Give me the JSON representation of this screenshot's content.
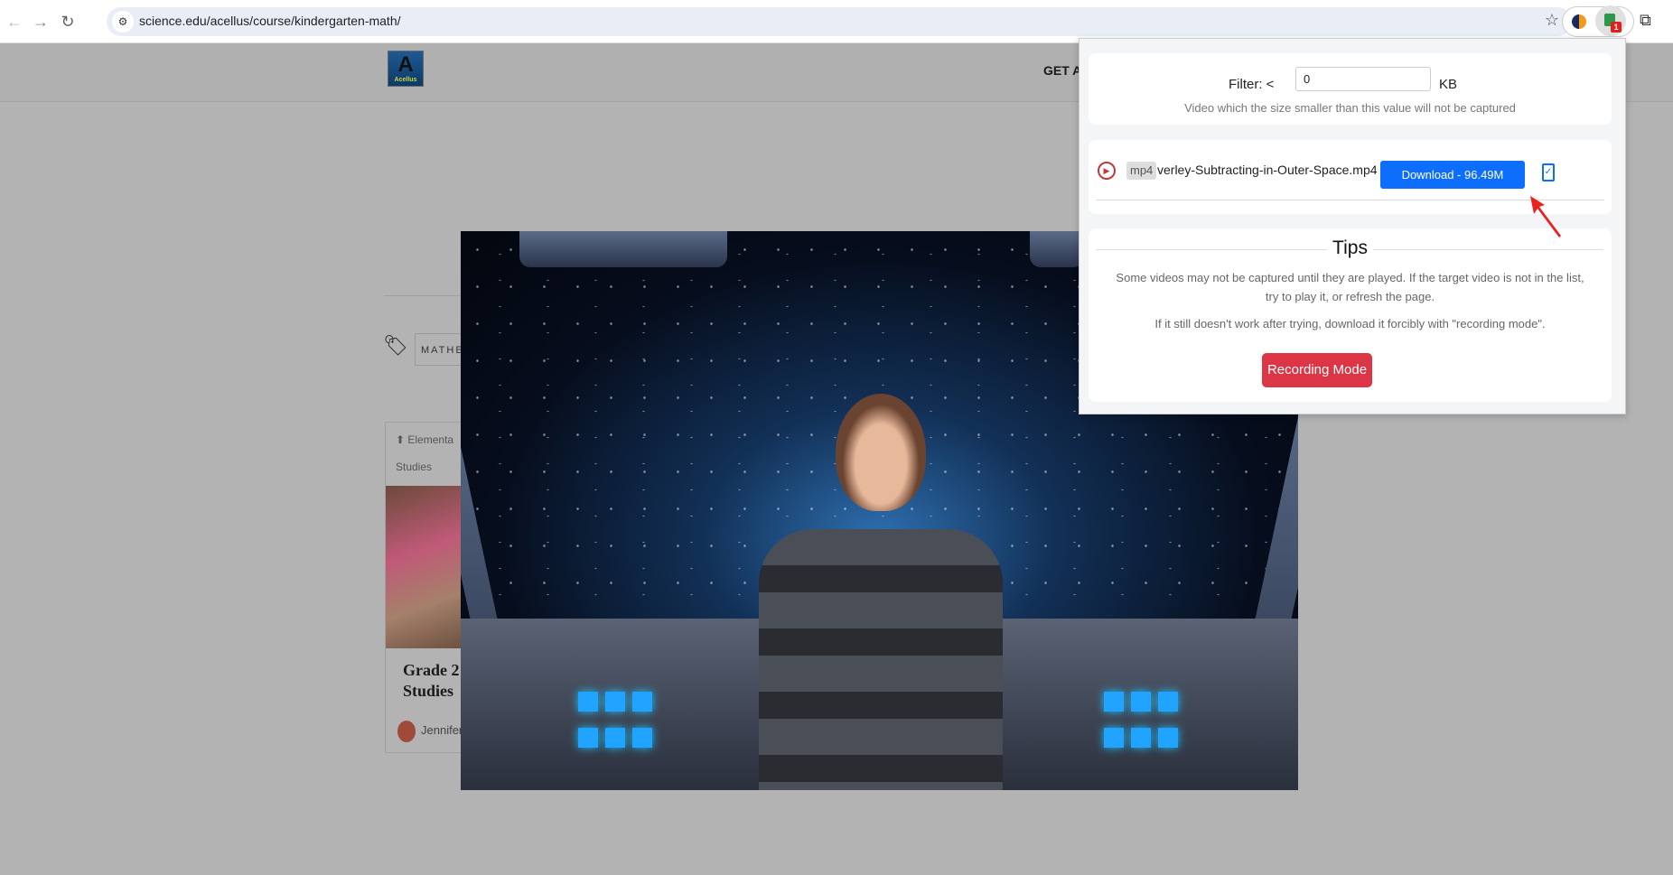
{
  "browser": {
    "url": "science.edu/acellus/course/kindergarten-math/",
    "extension_badge": "1"
  },
  "page": {
    "logo_text": "Acellus",
    "nav_partial": "GET A",
    "tag_partial": "MATHE",
    "card": {
      "category_partial": "Elementa",
      "category_line2": "Studies",
      "title_line1": "Grade 2",
      "title_line2": "Studies",
      "author_partial": "Jennifer"
    }
  },
  "popup": {
    "filter": {
      "label": "Filter:",
      "operator": "<",
      "value": "0",
      "unit": "KB",
      "hint": "Video which the size smaller than this value will not be captured"
    },
    "videos": [
      {
        "format": "mp4",
        "filename": "verley-Subtracting-in-Outer-Space.mp4",
        "download_label": "Download - 96.49M"
      }
    ],
    "tips": {
      "title": "Tips",
      "line1": "Some videos may not be captured until they are played. If the target video is not in the list,",
      "line2": "try to play it, or refresh the page.",
      "line3": "If it still doesn't work after trying, download it forcibly with \"recording mode\".",
      "button": "Recording Mode"
    }
  },
  "colors": {
    "download": "#0d6efd",
    "recording": "#dc3545",
    "annotation_arrow": "#e8231f"
  }
}
